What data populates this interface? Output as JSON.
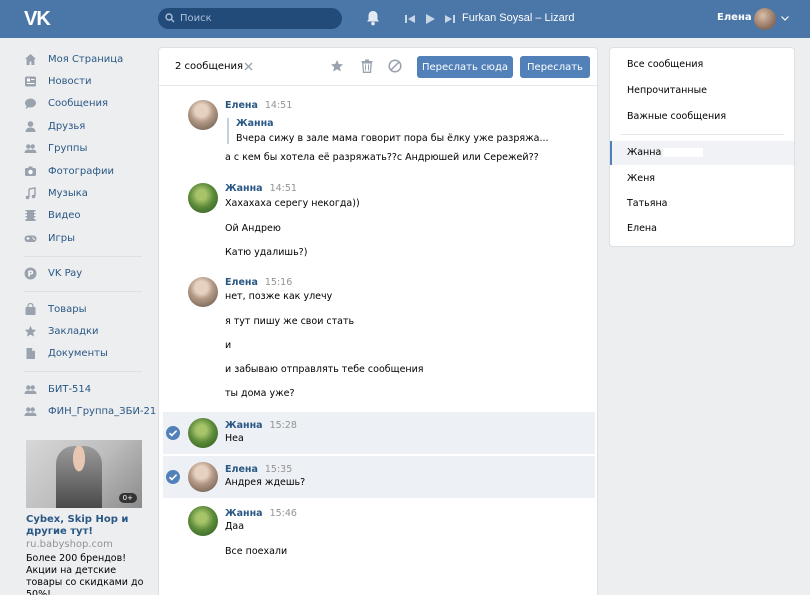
{
  "header": {
    "logo": "VK",
    "search_placeholder": "Поиск",
    "track": "Furkan Soysal – Lizard",
    "user_name": "Елена",
    "brand_color": "#4a76a8"
  },
  "nav": {
    "items": [
      {
        "label": "Моя Страница",
        "icon": "home-icon"
      },
      {
        "label": "Новости",
        "icon": "news-icon"
      },
      {
        "label": "Сообщения",
        "icon": "messages-icon"
      },
      {
        "label": "Друзья",
        "icon": "friends-icon"
      },
      {
        "label": "Группы",
        "icon": "groups-icon"
      },
      {
        "label": "Фотографии",
        "icon": "camera-icon"
      },
      {
        "label": "Музыка",
        "icon": "music-icon"
      },
      {
        "label": "Видео",
        "icon": "video-icon"
      },
      {
        "label": "Игры",
        "icon": "gamepad-icon"
      }
    ],
    "pay": {
      "label": "VK Pay"
    },
    "extra": [
      {
        "label": "Товары"
      },
      {
        "label": "Закладки"
      },
      {
        "label": "Документы"
      }
    ],
    "groups": [
      {
        "label": "БИТ-514"
      },
      {
        "label": "ФИН_Группа_ЗБИ-21"
      }
    ]
  },
  "ad": {
    "age_badge": "0+",
    "title": "Cybex, Skip Hop и другие тут!",
    "domain": "ru.babyshop.com",
    "text": "Более 200 брендов! Акции на детские товары со скидками до 50%!"
  },
  "toolbar": {
    "selected_count": "2 сообщения",
    "forward_here": "Переслать сюда",
    "forward": "Переслать"
  },
  "messages": [
    {
      "author": "Елена",
      "time": "14:51",
      "avatar": "elena",
      "selected": false,
      "quote": {
        "author": "Жанна",
        "text": "Вчера сижу в зале мама говорит пора бы ёлку уже разряжа..."
      },
      "lines": [
        "а с кем бы хотела её разряжать??с Андрюшей или Сережей??"
      ]
    },
    {
      "author": "Жанна",
      "time": "14:51",
      "avatar": "zhanna",
      "selected": false,
      "lines": [
        "Хахахаха серегу некогда))",
        "Ой Андрею",
        "Катю удалишь?)"
      ]
    },
    {
      "author": "Елена",
      "time": "15:16",
      "avatar": "elena",
      "selected": false,
      "lines": [
        "нет, позже как улечу",
        "я тут пишу же свои стать",
        "и",
        "и забываю отправлять тебе сообщения",
        "ты дома уже?"
      ]
    },
    {
      "author": "Жанна",
      "time": "15:28",
      "avatar": "zhanna",
      "selected": true,
      "lines": [
        "Неа"
      ]
    },
    {
      "author": "Елена",
      "time": "15:35",
      "avatar": "elena",
      "selected": true,
      "lines": [
        "Андрея ждешь?"
      ]
    },
    {
      "author": "Жанна",
      "time": "15:46",
      "avatar": "zhanna",
      "selected": false,
      "lines": [
        "Даа",
        "Все поехали"
      ]
    }
  ],
  "right_panel": {
    "filters": [
      "Все сообщения",
      "Непрочитанные",
      "Важные сообщения"
    ],
    "chats": [
      "Жанна",
      "Женя",
      "Татьяна",
      "Елена"
    ]
  }
}
